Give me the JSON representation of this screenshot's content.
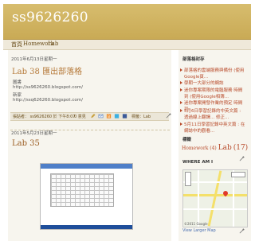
{
  "header": {
    "title": "ss9626260"
  },
  "nav": {
    "items": [
      "首頁",
      "Homework",
      "Lab"
    ]
  },
  "posts": [
    {
      "date": "2011年6月13日星期一",
      "title": "Lab 38 匯出部落格",
      "lines": [
        "圖書",
        "http://ss9626260.blogspot.com/",
        "新家",
        "http://ssq626260.blogspot.com/"
      ],
      "footer": {
        "meta": "張貼者： ss9626260 於 下午8:07",
        "comments": "0 意見",
        "labels": "標籤：Lab"
      }
    },
    {
      "date": "2011年5月23日星期一",
      "title": "Lab 35"
    }
  ],
  "sidebar": {
    "archive_heading": "部落格封存",
    "archive_items": [
      "部落格的雲端服務與備份 (使用Google頁...",
      "學期一大部分的網誌",
      "迷你專案期限的電腦服務 時間到 (使用Google相簿...",
      "迷你專案開發作業的預定 時間到",
      "5月6日學習記錄的中英文篇 : 透過線上翻譯... 修正...",
      "5月11日學習記錄中英文篇 : 在網誌中的觀看..."
    ],
    "labels_heading": "標籤",
    "labels": [
      {
        "name": "Homework",
        "count": "(4)"
      },
      {
        "name": "Lab",
        "count": "(17)"
      }
    ],
    "map_heading": "WHERE AM I",
    "map_copy": "©2011 Google",
    "map_link": "View Larger Map"
  },
  "colors": {
    "header": "#c9aa55",
    "link": "#b67a3a",
    "accent": "#b84a2a"
  }
}
